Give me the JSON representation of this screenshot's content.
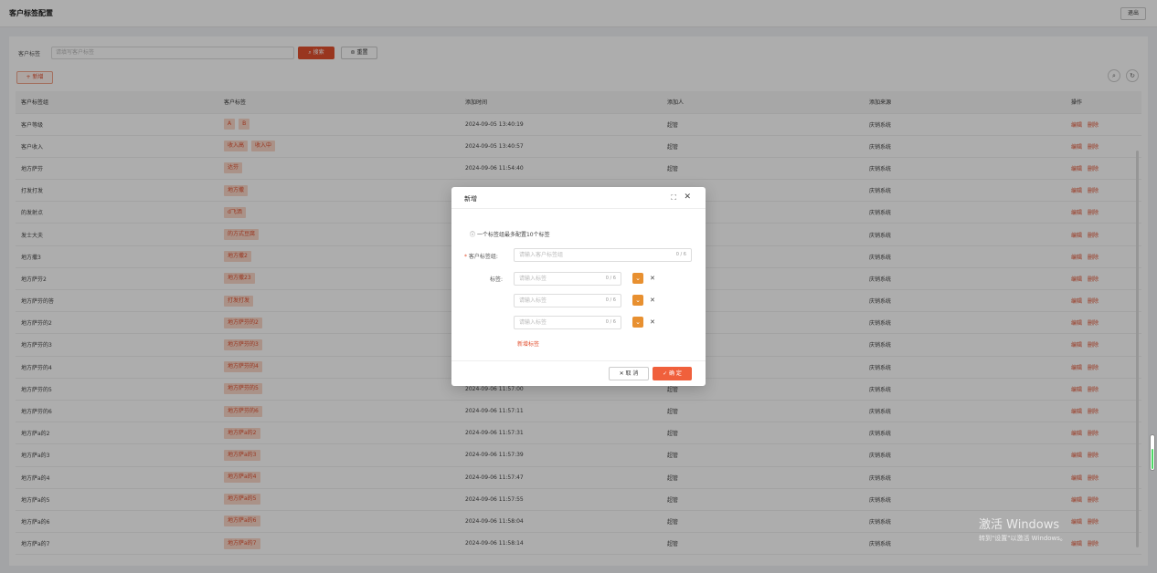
{
  "header": {
    "title": "客户标签配置",
    "logout": "退出"
  },
  "search": {
    "label": "客户标签",
    "placeholder": "请填写客户标签",
    "search_btn": "搜索",
    "reset_btn": "重置"
  },
  "toolbar": {
    "add_btn": "新增"
  },
  "table": {
    "columns": [
      "客户标签组",
      "客户标签",
      "添加时间",
      "添加人",
      "添加来源",
      "操作"
    ],
    "rows": [
      {
        "group": "客户等级",
        "tags": [
          "A",
          "B"
        ],
        "time": "2024-09-05 13:40:19",
        "user": "超管",
        "source": "庆销系统"
      },
      {
        "group": "客户收入",
        "tags": [
          "收入高",
          "收入中"
        ],
        "time": "2024-09-05 13:40:57",
        "user": "超管",
        "source": "庆销系统"
      },
      {
        "group": "地方萨芬",
        "tags": [
          "达芬"
        ],
        "time": "2024-09-06 11:54:40",
        "user": "超管",
        "source": "庆销系统"
      },
      {
        "group": "打发打发",
        "tags": [
          "地方撒"
        ],
        "time": "",
        "user": "",
        "source": "庆销系统"
      },
      {
        "group": "的发射点",
        "tags": [
          "d飞洒"
        ],
        "time": "",
        "user": "",
        "source": "庆销系统"
      },
      {
        "group": "发士大夫",
        "tags": [
          "的方式豆腐"
        ],
        "time": "",
        "user": "",
        "source": "庆销系统"
      },
      {
        "group": "地方撒3",
        "tags": [
          "地方撒2"
        ],
        "time": "",
        "user": "",
        "source": "庆销系统"
      },
      {
        "group": "地方萨芬2",
        "tags": [
          "地方撒23"
        ],
        "time": "",
        "user": "",
        "source": "庆销系统"
      },
      {
        "group": "地方萨芬的答",
        "tags": [
          "打发打发"
        ],
        "time": "",
        "user": "",
        "source": "庆销系统"
      },
      {
        "group": "地方萨芬的2",
        "tags": [
          "地方萨芬的2"
        ],
        "time": "",
        "user": "",
        "source": "庆销系统"
      },
      {
        "group": "地方萨芬的3",
        "tags": [
          "地方萨芬的3"
        ],
        "time": "",
        "user": "",
        "source": "庆销系统"
      },
      {
        "group": "地方萨芬的4",
        "tags": [
          "地方萨芬的4"
        ],
        "time": "",
        "user": "",
        "source": "庆销系统"
      },
      {
        "group": "地方萨芬的5",
        "tags": [
          "地方萨芬的5"
        ],
        "time": "2024-09-06 11:57:00",
        "user": "超管",
        "source": "庆销系统"
      },
      {
        "group": "地方萨芬的6",
        "tags": [
          "地方萨芬的6"
        ],
        "time": "2024-09-06 11:57:11",
        "user": "超管",
        "source": "庆销系统"
      },
      {
        "group": "地方萨a的2",
        "tags": [
          "地方萨a的2"
        ],
        "time": "2024-09-06 11:57:31",
        "user": "超管",
        "source": "庆销系统"
      },
      {
        "group": "地方萨a的3",
        "tags": [
          "地方萨a的3"
        ],
        "time": "2024-09-06 11:57:39",
        "user": "超管",
        "source": "庆销系统"
      },
      {
        "group": "地方萨a的4",
        "tags": [
          "地方萨a的4"
        ],
        "time": "2024-09-06 11:57:47",
        "user": "超管",
        "source": "庆销系统"
      },
      {
        "group": "地方萨a的5",
        "tags": [
          "地方萨a的5"
        ],
        "time": "2024-09-06 11:57:55",
        "user": "超管",
        "source": "庆销系统"
      },
      {
        "group": "地方萨a的6",
        "tags": [
          "地方萨a的6"
        ],
        "time": "2024-09-06 11:58:04",
        "user": "超管",
        "source": "庆销系统"
      },
      {
        "group": "地方萨a的7",
        "tags": [
          "地方萨a的7"
        ],
        "time": "2024-09-06 11:58:14",
        "user": "超管",
        "source": "庆销系统"
      }
    ],
    "edit": "编辑",
    "delete": "删除"
  },
  "modal": {
    "title": "新增",
    "info": "一个标签组最多配置10个标签",
    "group_label": "客户标签组:",
    "group_placeholder": "请输入客户标签组",
    "group_count": "0 / 6",
    "tag_label": "标签:",
    "tag_placeholder": "请输入标签",
    "tag_count": "0 / 6",
    "new_tag": "新增标签",
    "cancel": "取 消",
    "ok": "确 定"
  },
  "watermark": {
    "line1": "激活 Windows",
    "line2": "转到\"设置\"以激活 Windows。"
  },
  "colors": {
    "accent": "#e2502f",
    "tag_bg": "#fbd7c9",
    "arrow_btn": "#e89030"
  }
}
